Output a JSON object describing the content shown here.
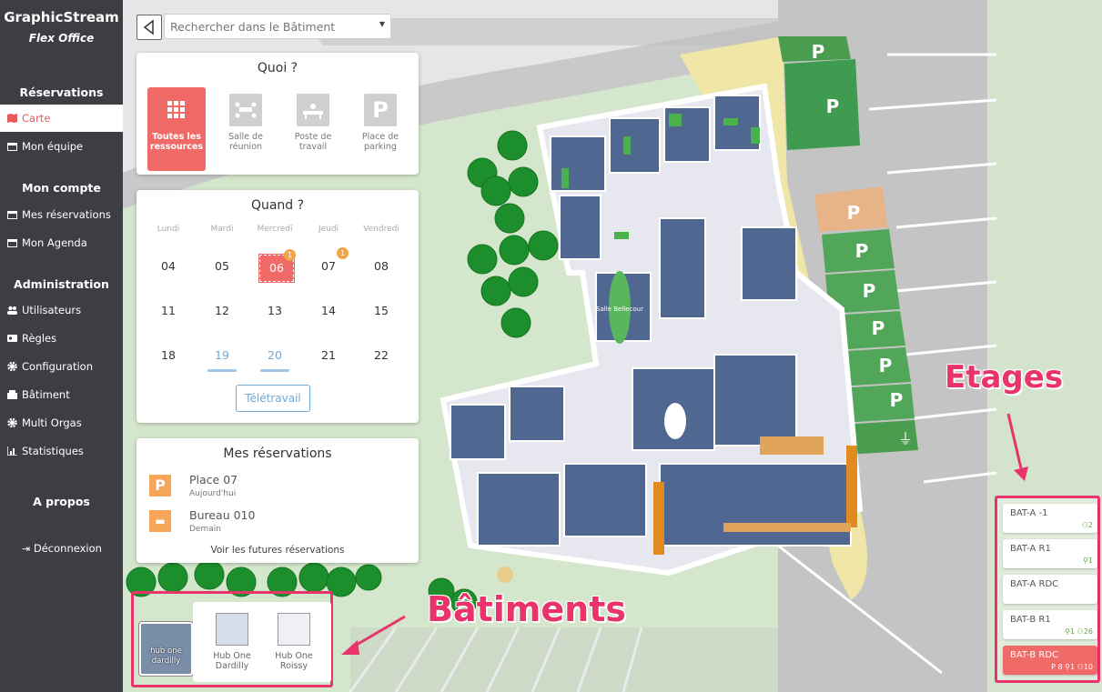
{
  "brand": {
    "name": "GraphicStream",
    "subtitle": "Flex Office"
  },
  "sidebar": {
    "sections": {
      "reservations": "Réservations",
      "account": "Mon compte",
      "admin": "Administration",
      "about": "A propos"
    },
    "items": [
      {
        "label": "Carte",
        "icon": "map-icon",
        "active": true
      },
      {
        "label": "Mon équipe",
        "icon": "calendar-icon"
      },
      {
        "label": "Mes réservations",
        "icon": "calendar-icon"
      },
      {
        "label": "Mon Agenda",
        "icon": "calendar-icon"
      },
      {
        "label": "Utilisateurs",
        "icon": "users-icon"
      },
      {
        "label": "Règles",
        "icon": "id-card-icon"
      },
      {
        "label": "Configuration",
        "icon": "gear-icon"
      },
      {
        "label": "Bâtiment",
        "icon": "building-icon"
      },
      {
        "label": "Multi Orgas",
        "icon": "gear-icon"
      },
      {
        "label": "Statistiques",
        "icon": "bar-chart-icon"
      }
    ],
    "logout": "Déconnexion"
  },
  "search": {
    "placeholder": "Rechercher dans le Bâtiment"
  },
  "what": {
    "title": "Quoi ?",
    "tiles": [
      {
        "label": "Toutes les ressources",
        "icon": "grid-icon",
        "selected": true
      },
      {
        "label": "Salle de réunion",
        "icon": "meeting-room-icon"
      },
      {
        "label": "Poste de travail",
        "icon": "desk-icon"
      },
      {
        "label": "Place de parking",
        "icon": "parking-icon",
        "glyph": "P"
      }
    ]
  },
  "when": {
    "title": "Quand ?",
    "days": [
      "Lundi",
      "Mardi",
      "Mercredi",
      "Jeudi",
      "Vendredi"
    ],
    "weeks": [
      [
        "04",
        "05",
        "06",
        "07",
        "08"
      ],
      [
        "11",
        "12",
        "13",
        "14",
        "15"
      ],
      [
        "18",
        "19",
        "20",
        "21",
        "22"
      ]
    ],
    "badges": [
      "1",
      "1"
    ],
    "telework_button": "Télétravail"
  },
  "reservations": {
    "title": "Mes réservations",
    "items": [
      {
        "title": "Place 07",
        "sub": "Aujourd'hui",
        "glyph": "P"
      },
      {
        "title": "Bureau 010",
        "sub": "Demain",
        "glyph": "▬"
      }
    ],
    "future_link": "Voir les futures réservations"
  },
  "map": {
    "room_label": "Salle Bellecour",
    "parking_glyph": "P"
  },
  "buildings": {
    "items": [
      {
        "label": "hub one dardilly",
        "selected": true
      },
      {
        "label": "Hub One Dardilly"
      },
      {
        "label": "Hub One Roissy"
      }
    ]
  },
  "floors": [
    {
      "name": "BAT-A -1",
      "stats": "⚇2"
    },
    {
      "name": "BAT-A R1",
      "stats": "⚲1"
    },
    {
      "name": "BAT-A RDC",
      "stats": ""
    },
    {
      "name": "BAT-B R1",
      "stats": "⚲1   ⚇26"
    },
    {
      "name": "BAT-B RDC",
      "stats": "P 8   ⚲1   ⚇10",
      "selected": true
    }
  ],
  "annotations": {
    "buildings": "Bâtiments",
    "floors": "Etages"
  },
  "colors": {
    "accent": "#f06a68",
    "sidebar": "#3d3d44",
    "parking": "#3e9b4f",
    "floor": "#4f6791",
    "annotation": "#e8336b"
  }
}
